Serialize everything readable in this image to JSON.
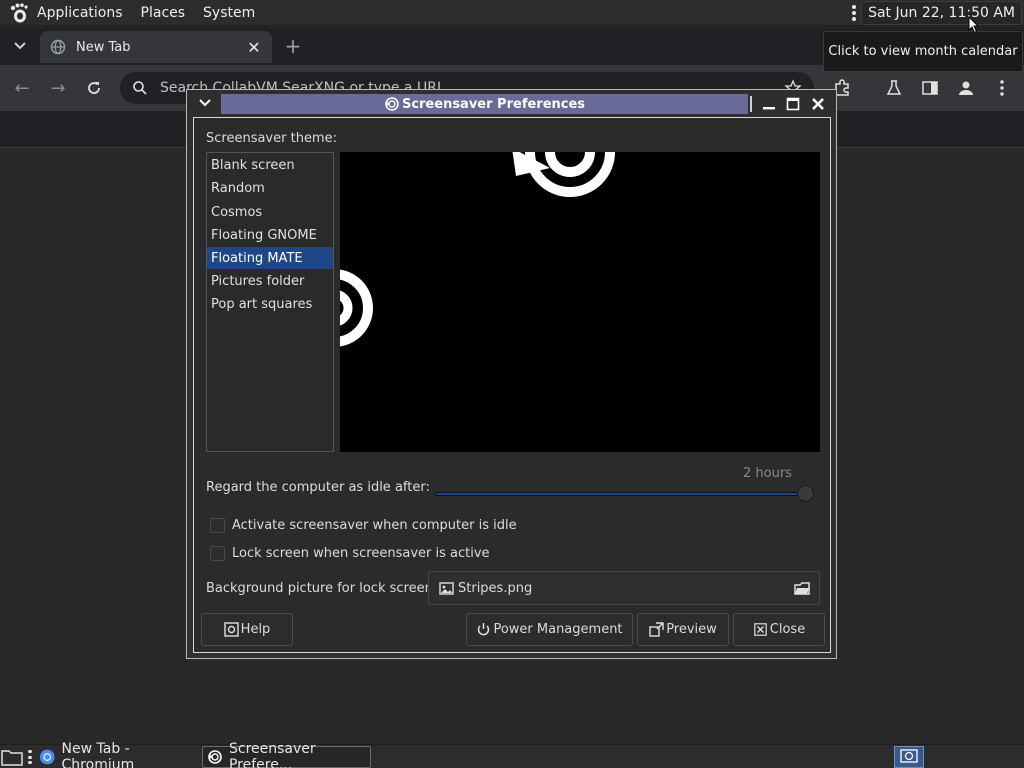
{
  "top_panel": {
    "menus": [
      "Applications",
      "Places",
      "System"
    ],
    "clock": "Sat Jun 22, 11:50 AM",
    "tooltip": "Click to view month calendar"
  },
  "browser": {
    "tab_title": "New Tab",
    "omnibox_placeholder": "Search CollabVM SearXNG or type a URL"
  },
  "dialog": {
    "title": "Screensaver Preferences",
    "theme_label": "Screensaver theme:",
    "themes": [
      "Blank screen",
      "Random",
      "Cosmos",
      "Floating GNOME",
      "Floating MATE",
      "Pictures folder",
      "Pop art squares"
    ],
    "selected_theme": "Floating MATE",
    "idle_label": "Regard the computer as idle after:",
    "idle_value": "2 hours",
    "idle_slider_fraction": 1.0,
    "activate_label": "Activate screensaver when computer is idle",
    "activate_checked": false,
    "lock_label": "Lock screen when screensaver is active",
    "lock_checked": false,
    "bg_label": "Background picture for lock screen:",
    "bg_file": "Stripes.png",
    "buttons": {
      "help": "Help",
      "power": "Power Management",
      "preview": "Preview",
      "close": "Close"
    }
  },
  "taskbar": {
    "items": [
      "New Tab - Chromium",
      "Screensaver Prefere..."
    ]
  },
  "colors": {
    "selection": "#1f4787",
    "title_bar_active": "#6a6a98",
    "tray_icon_bg": "#3a5a8c"
  }
}
